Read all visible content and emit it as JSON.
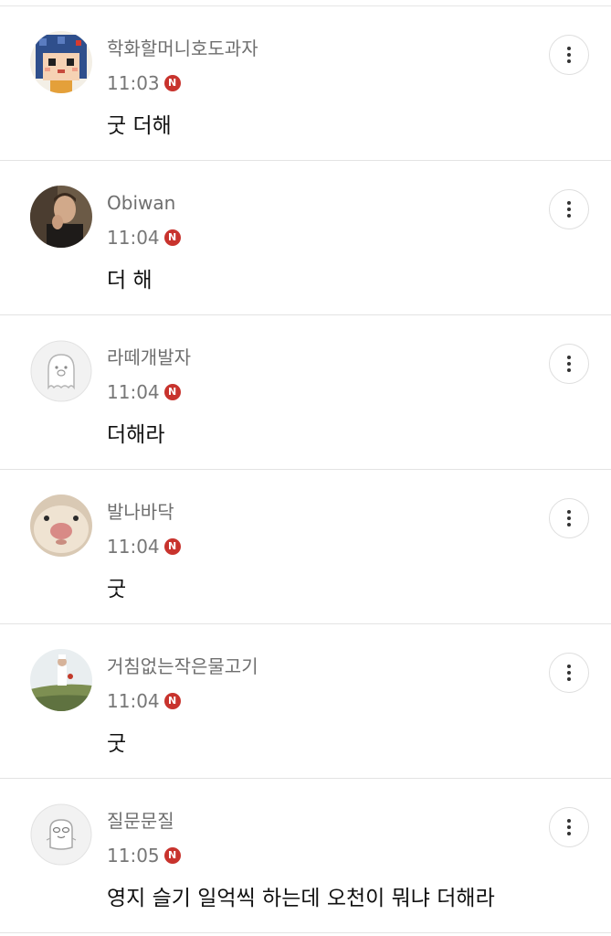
{
  "comments": [
    {
      "author": "학화할머니호도과자",
      "time": "11:03",
      "badge": "N",
      "text": "굿 더해",
      "avatar_icon": "pixel-character-avatar-icon"
    },
    {
      "author": "Obiwan",
      "time": "11:04",
      "badge": "N",
      "text": "더 해",
      "avatar_icon": "man-photo-avatar-icon"
    },
    {
      "author": "라떼개발자",
      "time": "11:04",
      "badge": "N",
      "text": "더해라",
      "avatar_icon": "default-ghost-avatar-icon"
    },
    {
      "author": "발나바닥",
      "time": "11:04",
      "badge": "N",
      "text": "굿",
      "avatar_icon": "hamster-photo-avatar-icon"
    },
    {
      "author": "거침없는작은물고기",
      "time": "11:04",
      "badge": "N",
      "text": "굿",
      "avatar_icon": "field-photo-avatar-icon"
    },
    {
      "author": "질문문질",
      "time": "11:05",
      "badge": "N",
      "text": "영지 슬기 일억씩 하는데 오천이 뭐냐 더해라",
      "avatar_icon": "default-cat-avatar-icon"
    }
  ],
  "colors": {
    "badge": "#c8332d",
    "author_text": "#6e6e6e",
    "divider": "#e3e3e3"
  },
  "more_icon": "more-vertical-icon"
}
